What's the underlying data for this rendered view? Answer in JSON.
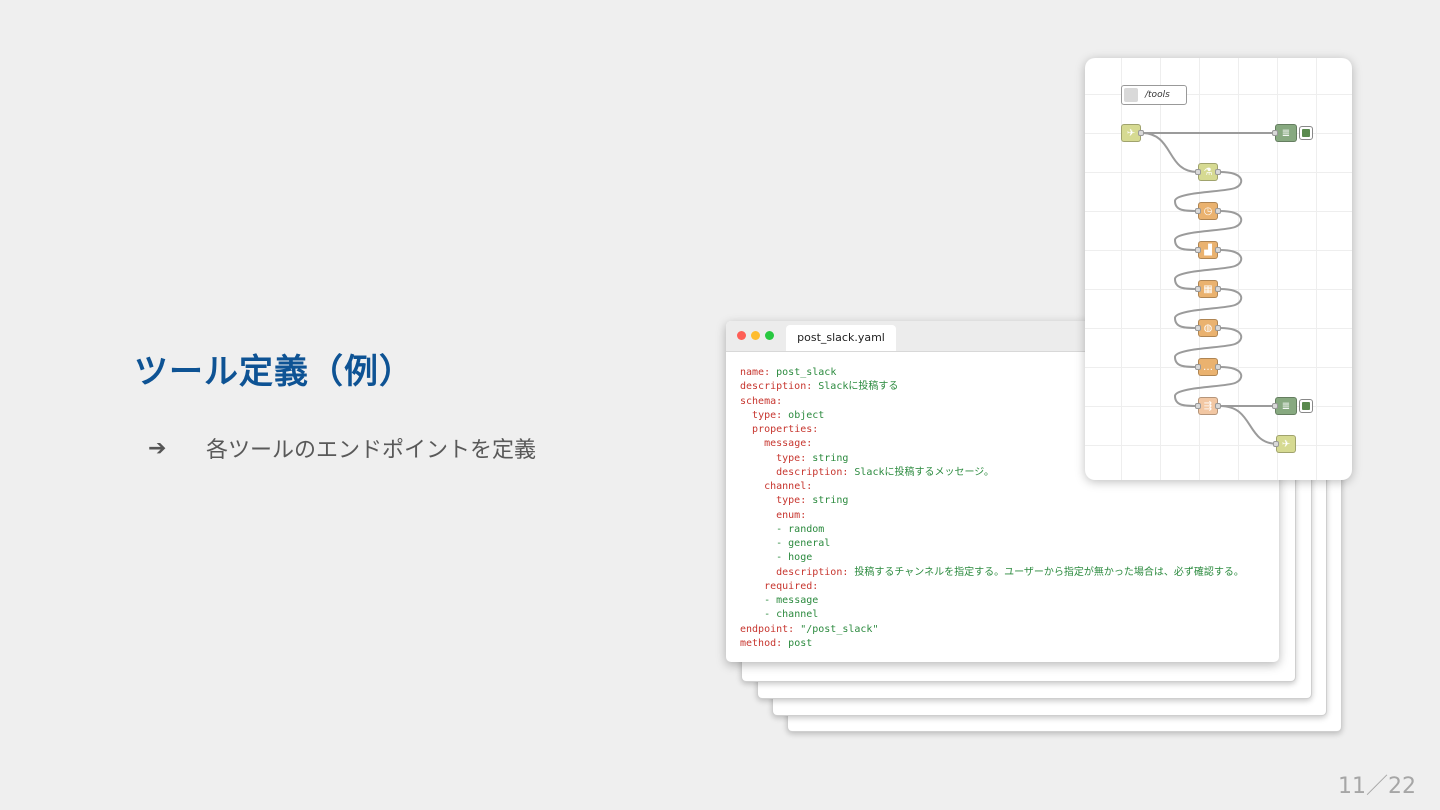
{
  "slide": {
    "title": "ツール定義（例）",
    "bullet_arrow": "➔",
    "bullet_text": "各ツールのエンドポイントを定義",
    "page_number": "11／22"
  },
  "code_window": {
    "filename": "post_slack.yaml",
    "lines": [
      {
        "indent": "",
        "key": "name:",
        "value": " post_slack"
      },
      {
        "indent": "",
        "key": "description:",
        "value": " Slackに投稿する"
      },
      {
        "indent": "",
        "key": "schema:",
        "value": ""
      },
      {
        "indent": "  ",
        "key": "type:",
        "value": " object"
      },
      {
        "indent": "  ",
        "key": "properties:",
        "value": ""
      },
      {
        "indent": "    ",
        "key": "message:",
        "value": ""
      },
      {
        "indent": "      ",
        "key": "type:",
        "value": " string"
      },
      {
        "indent": "      ",
        "key": "description:",
        "value": " Slackに投稿するメッセージ。"
      },
      {
        "indent": "    ",
        "key": "channel:",
        "value": ""
      },
      {
        "indent": "      ",
        "key": "type:",
        "value": " string"
      },
      {
        "indent": "      ",
        "key": "enum:",
        "value": ""
      },
      {
        "indent": "      ",
        "key": "",
        "value": "- random"
      },
      {
        "indent": "      ",
        "key": "",
        "value": "- general"
      },
      {
        "indent": "      ",
        "key": "",
        "value": "- hoge"
      },
      {
        "indent": "      ",
        "key": "description:",
        "value": " 投稿するチャンネルを指定する。ユーザーから指定が無かった場合は、必ず確認する。"
      },
      {
        "indent": "    ",
        "key": "required:",
        "value": ""
      },
      {
        "indent": "    ",
        "key": "",
        "value": "- message"
      },
      {
        "indent": "    ",
        "key": "",
        "value": "- channel"
      },
      {
        "indent": "",
        "key": "endpoint:",
        "value": " \"/post_slack\""
      },
      {
        "indent": "",
        "key": "method:",
        "value": " post"
      }
    ]
  },
  "flow_panel": {
    "tab_label": "/tools",
    "nodes": [
      {
        "name": "http-in-node",
        "icon": "globe-icon",
        "glyph": "✈"
      },
      {
        "name": "debug-node-top",
        "icon": "list-icon",
        "glyph": "≣"
      },
      {
        "name": "flask-node",
        "icon": "flask-icon",
        "glyph": "⚗"
      },
      {
        "name": "clock-node",
        "icon": "clock-icon",
        "glyph": "◷"
      },
      {
        "name": "factory-node",
        "icon": "factory-icon",
        "glyph": "▟"
      },
      {
        "name": "grid-node",
        "icon": "grid-icon",
        "glyph": "▦"
      },
      {
        "name": "bug-node",
        "icon": "bug-icon",
        "glyph": "◍"
      },
      {
        "name": "comment-node",
        "icon": "comment-icon",
        "glyph": "…"
      },
      {
        "name": "switch-node",
        "icon": "switch-icon",
        "glyph": "⇶"
      },
      {
        "name": "debug-node-bottom",
        "icon": "list-icon",
        "glyph": "≣"
      },
      {
        "name": "http-response-node",
        "icon": "globe-icon",
        "glyph": "✈"
      }
    ]
  },
  "colors": {
    "title": "#0e5394",
    "yaml_key": "#c7362f",
    "yaml_value": "#2b8a3e",
    "node_olive": "#d6da92",
    "node_orange": "#eab26f",
    "node_green": "#87a980"
  }
}
